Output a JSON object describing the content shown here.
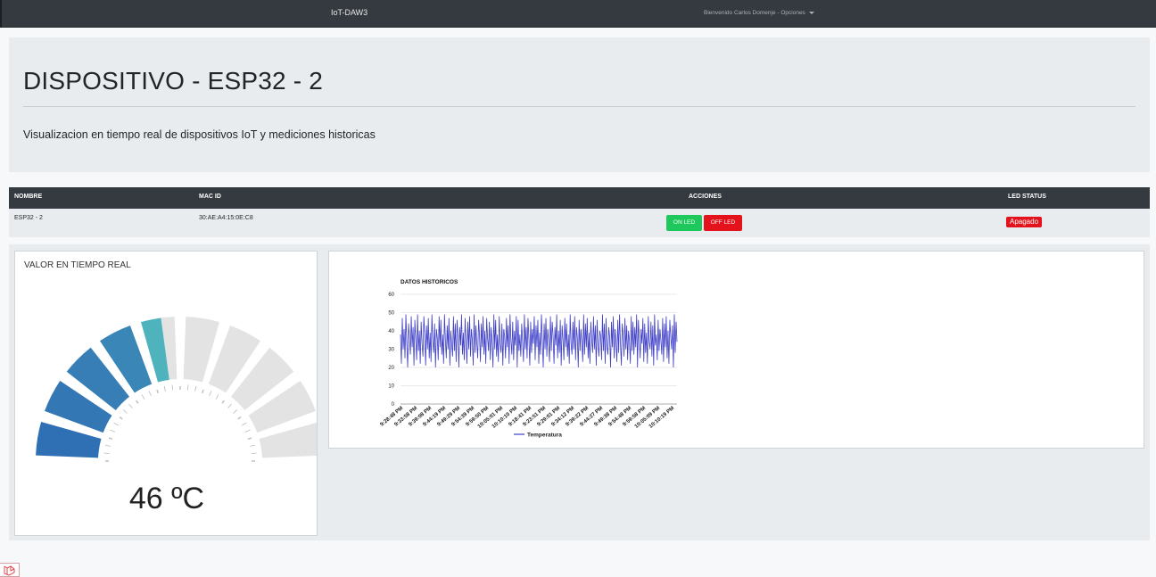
{
  "navbar": {
    "brand": "IoT-DAW3",
    "user_menu": "Bienvenido Carlos Domenje - Opciones"
  },
  "jumbotron": {
    "title": "DISPOSITIVO - ESP32 - 2",
    "lead": "Visualizacion en tiempo real de dispositivos IoT y mediciones historicas"
  },
  "table": {
    "headers": [
      "NOMBRE",
      "MAC ID",
      "ACCIONES",
      "LED STATUS"
    ],
    "row": {
      "nombre": "ESP32 - 2",
      "mac": "30:AE:A4:15:0E:C8",
      "on_label": "ON LED",
      "off_label": "OFF LED",
      "status": "Apagado"
    }
  },
  "gauge": {
    "title": "VALOR EN TIEMPO REAL",
    "value": 46,
    "max": 100,
    "display": "46 ºC"
  },
  "chart_data": {
    "type": "line",
    "title": "DATOS HISTORICOS",
    "ylim": [
      0,
      60
    ],
    "yticks": [
      "0",
      "10",
      "20",
      "30",
      "40",
      "50",
      "60"
    ],
    "x_tick_labels": [
      "9:28:48 PM",
      "9:33:58 PM",
      "9:39:08 PM",
      "9:44:19 PM",
      "9:49:29 PM",
      "9:54:39 PM",
      "9:59:50 PM",
      "10:05:01 PM",
      "10:10:10 PM",
      "9:18:41 PM",
      "9:23:51 PM",
      "9:29:01 PM",
      "9:34:12 PM",
      "9:39:22 PM",
      "9:44:27 PM",
      "9:49:38 PM",
      "9:54:48 PM",
      "9:59:58 PM",
      "10:05:09 PM",
      "10:10:19 PM"
    ],
    "series": [
      {
        "name": "Temperatura",
        "color": "#4040c8",
        "values": [
          38,
          22,
          47,
          30,
          41,
          25,
          49,
          33,
          20,
          44,
          36,
          27,
          48,
          31,
          42,
          21,
          46,
          35,
          24,
          49,
          29,
          40,
          22,
          45,
          33,
          26,
          48,
          38,
          21,
          43,
          30,
          47,
          25,
          39,
          23,
          49,
          34,
          28,
          44,
          20,
          41,
          36,
          24,
          48,
          31,
          46,
          27,
          38,
          22,
          49,
          35,
          25,
          43,
          30,
          47,
          21,
          40,
          33,
          26,
          48,
          29,
          44,
          23,
          46,
          37,
          20,
          42,
          32,
          49,
          27,
          39,
          24,
          47,
          34,
          22,
          45,
          30,
          48,
          26,
          41,
          35,
          21,
          49,
          28,
          43,
          33,
          25,
          46,
          38,
          23,
          44,
          31,
          48,
          27,
          40,
          22,
          47,
          36,
          29,
          45,
          24,
          42,
          34,
          20,
          49,
          30,
          46,
          26,
          38,
          23,
          48,
          33,
          28,
          44,
          21,
          41,
          37,
          25,
          47,
          31,
          43,
          22,
          49,
          35,
          27,
          45,
          24,
          40,
          32,
          48,
          20,
          46,
          29,
          38,
          26,
          44,
          34,
          23,
          49,
          30,
          42,
          25,
          47,
          36,
          21,
          45,
          28,
          41,
          33,
          48,
          24,
          43,
          31,
          46,
          22,
          39,
          27,
          49,
          35,
          20,
          44,
          30,
          47,
          26,
          41,
          34,
          23,
          48,
          29,
          45,
          37,
          22,
          42,
          32,
          49,
          25,
          40,
          28,
          46,
          21,
          43,
          35,
          24,
          47,
          31,
          44,
          26,
          38,
          22,
          49,
          33,
          27,
          45,
          30,
          48,
          24,
          42,
          36,
          20,
          46,
          29,
          41,
          34,
          23,
          49,
          27,
          44,
          31,
          47,
          25,
          39,
          22,
          45,
          35,
          28,
          48,
          30,
          43,
          21,
          46,
          33,
          26,
          40,
          37,
          24,
          49,
          29,
          44,
          22,
          47,
          32,
          27,
          42,
          36,
          20,
          45,
          31,
          48,
          25,
          41,
          34,
          23,
          46,
          28,
          49,
          33,
          21,
          44,
          38,
          26,
          47,
          30,
          43,
          24,
          40,
          35,
          22,
          48,
          29,
          45,
          27,
          42,
          31,
          49,
          20,
          46,
          36,
          25,
          41,
          33,
          47,
          23,
          44,
          28,
          39,
          22,
          48,
          34,
          30,
          45,
          26,
          43,
          21,
          49,
          32,
          38,
          24,
          46,
          29,
          41,
          35,
          27,
          47,
          23,
          44,
          31,
          48,
          25,
          40,
          22,
          46,
          37,
          30,
          43,
          20,
          49,
          28,
          45,
          34
        ]
      }
    ]
  },
  "colors": {
    "navbar": "#343a40",
    "btn_on": "#1ec85c",
    "btn_off": "#e3121b",
    "gauge_start": "#2f6fb3",
    "gauge_end": "#4fb3bd",
    "gauge_empty": "#e3e3e3"
  },
  "icons": {
    "corner": "laravel-icon"
  }
}
